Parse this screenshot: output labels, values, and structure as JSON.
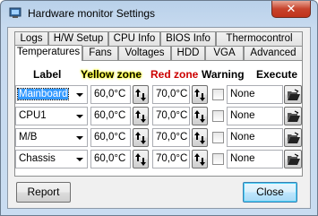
{
  "window": {
    "title": "Hardware monitor Settings",
    "close_glyph": "✕"
  },
  "tabs_back": [
    "Logs",
    "H/W Setup",
    "CPU Info",
    "BIOS Info",
    "Thermocontrol"
  ],
  "tabs_front": [
    "Temperatures",
    "Fans",
    "Voltages",
    "HDD",
    "VGA",
    "Advanced"
  ],
  "active_tab": "Temperatures",
  "headers": {
    "label": "Label",
    "yellow": "Yellow zone",
    "red": "Red zone",
    "warning": "Warning",
    "execute": "Execute"
  },
  "colors": {
    "yellow_zone": "#ffff00",
    "red_zone": "#cc0000"
  },
  "rows": [
    {
      "label": "Mainboard",
      "yellow": "60,0°C",
      "red": "70,0°C",
      "warning": false,
      "execute": "None"
    },
    {
      "label": "CPU1",
      "yellow": "60,0°C",
      "red": "70,0°C",
      "warning": false,
      "execute": "None"
    },
    {
      "label": "M/B",
      "yellow": "60,0°C",
      "red": "70,0°C",
      "warning": false,
      "execute": "None"
    },
    {
      "label": "Chassis",
      "yellow": "60,0°C",
      "red": "70,0°C",
      "warning": false,
      "execute": "None"
    }
  ],
  "buttons": {
    "report": "Report",
    "close": "Close"
  }
}
